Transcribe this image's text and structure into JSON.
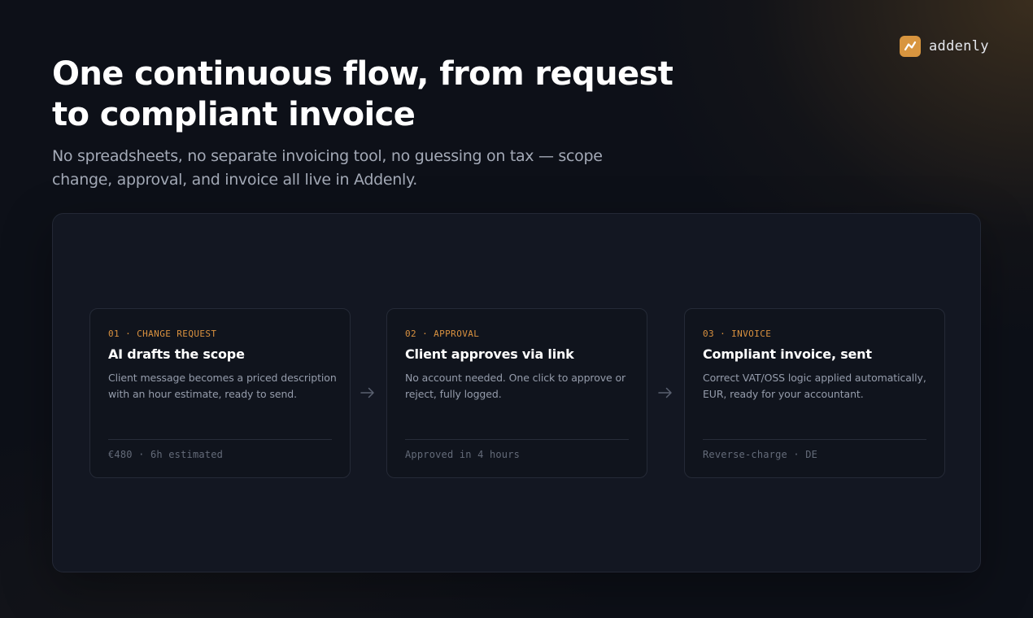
{
  "brand": {
    "name": "addenly",
    "accent": "#d8953f"
  },
  "hero": {
    "title": "One continuous flow, from request to compliant invoice",
    "subtitle": "No spreadsheets, no separate invoicing tool, no guessing on tax — scope change, approval, and invoice all live in Addenly."
  },
  "steps": [
    {
      "label": "01 · CHANGE REQUEST",
      "title": "AI drafts the scope",
      "description": "Client message becomes a priced description with an hour estimate, ready to send.",
      "meta": "€480 · 6h estimated"
    },
    {
      "label": "02 · APPROVAL",
      "title": "Client approves via link",
      "description": "No account needed. One click to approve or reject, fully logged.",
      "meta": "Approved in 4 hours"
    },
    {
      "label": "03 · INVOICE",
      "title": "Compliant invoice, sent",
      "description": "Correct VAT/OSS logic applied automatically, EUR, ready for your accountant.",
      "meta": "Reverse-charge · DE"
    }
  ],
  "icons": {
    "logo": "trend-chart-icon",
    "connector": "arrow-right-icon"
  }
}
